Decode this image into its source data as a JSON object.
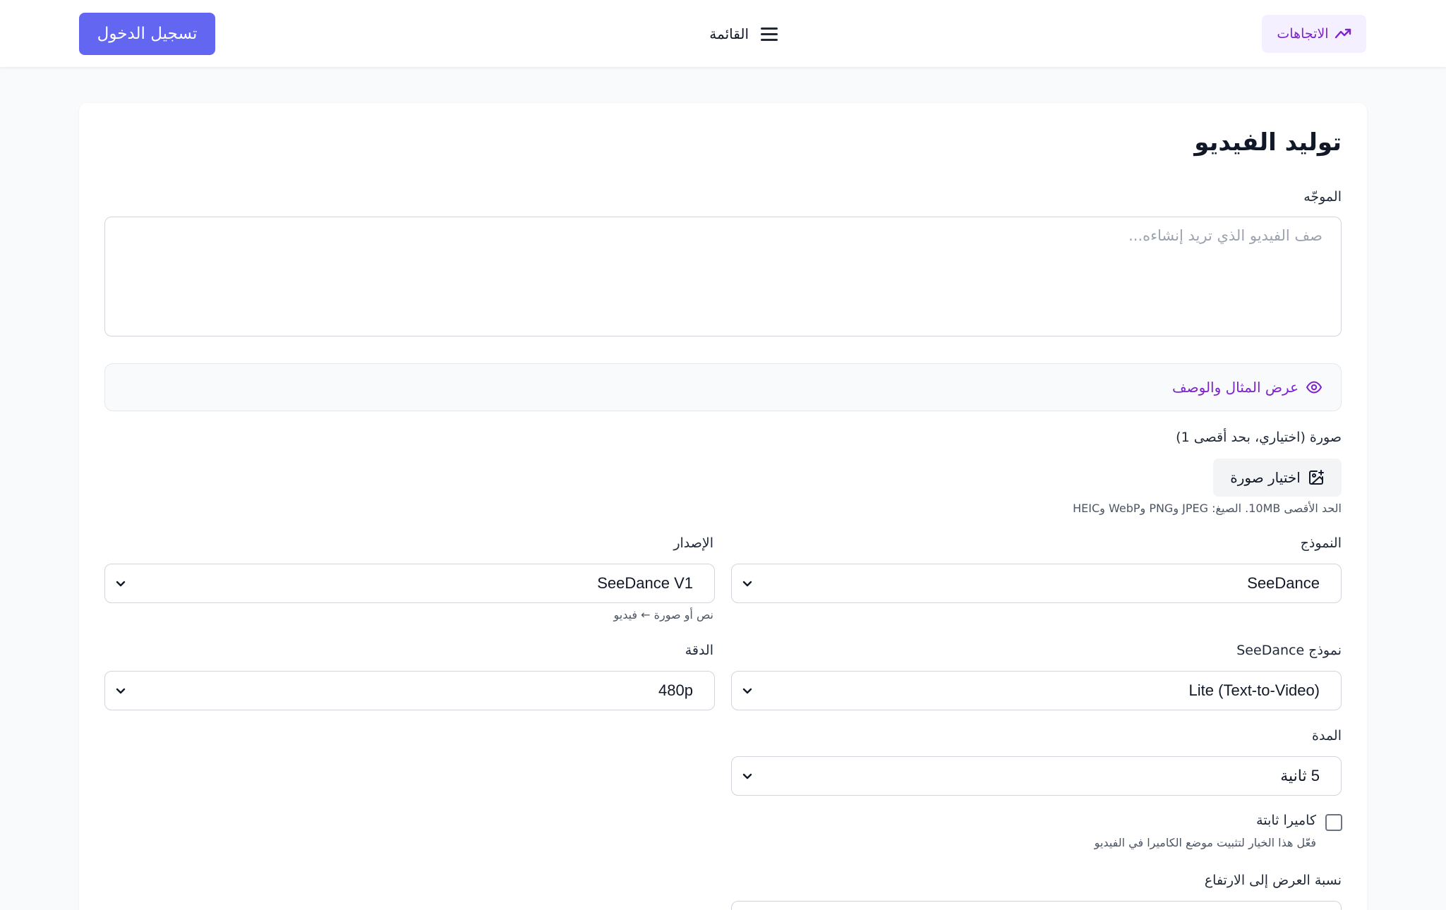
{
  "header": {
    "login_label": "تسجيل الدخول",
    "menu_label": "القائمة",
    "trends_label": "الاتجاهات"
  },
  "form": {
    "title": "توليد الفيديو",
    "prompt_label": "الموجّه",
    "prompt_placeholder": "صف الفيديو الذي تريد إنشاءه...",
    "prompt_value": "",
    "example_toggle_label": "عرض المثال والوصف",
    "image_label": "صورة (اختياري، بحد أقصى 1)",
    "choose_image_label": "اختيار صورة",
    "image_hint": "الحد الأقصى 10MB. الصيغ: JPEG وPNG وWebP وHEIC",
    "model_label": "النموذج",
    "model_value": "SeeDance",
    "version_label": "الإصدار",
    "version_value": "SeeDance V1",
    "version_hint": "نص أو صورة ← فيديو",
    "seedance_model_label": "نموذج SeeDance",
    "seedance_model_value": "Lite (Text-to-Video)",
    "resolution_label": "الدقة",
    "resolution_value": "480p",
    "duration_label": "المدة",
    "duration_value": "5 ثانية",
    "fixed_camera_label": "كاميرا ثابتة",
    "fixed_camera_checked": false,
    "fixed_camera_hint": "فعّل هذا الخيار لتثبيت موضع الكاميرا في الفيديو",
    "aspect_ratio_label": "نسبة العرض إلى الارتفاع"
  },
  "colors": {
    "primary": "#6366f1",
    "accent_purple": "#7e22ce",
    "trends_bg": "#f5f0ff"
  },
  "icons": {
    "trends": "trending-up-icon",
    "menu": "hamburger-menu-icon",
    "example": "eye-icon",
    "choose_image": "image-plus-icon",
    "select": "chevron-down-icon"
  }
}
